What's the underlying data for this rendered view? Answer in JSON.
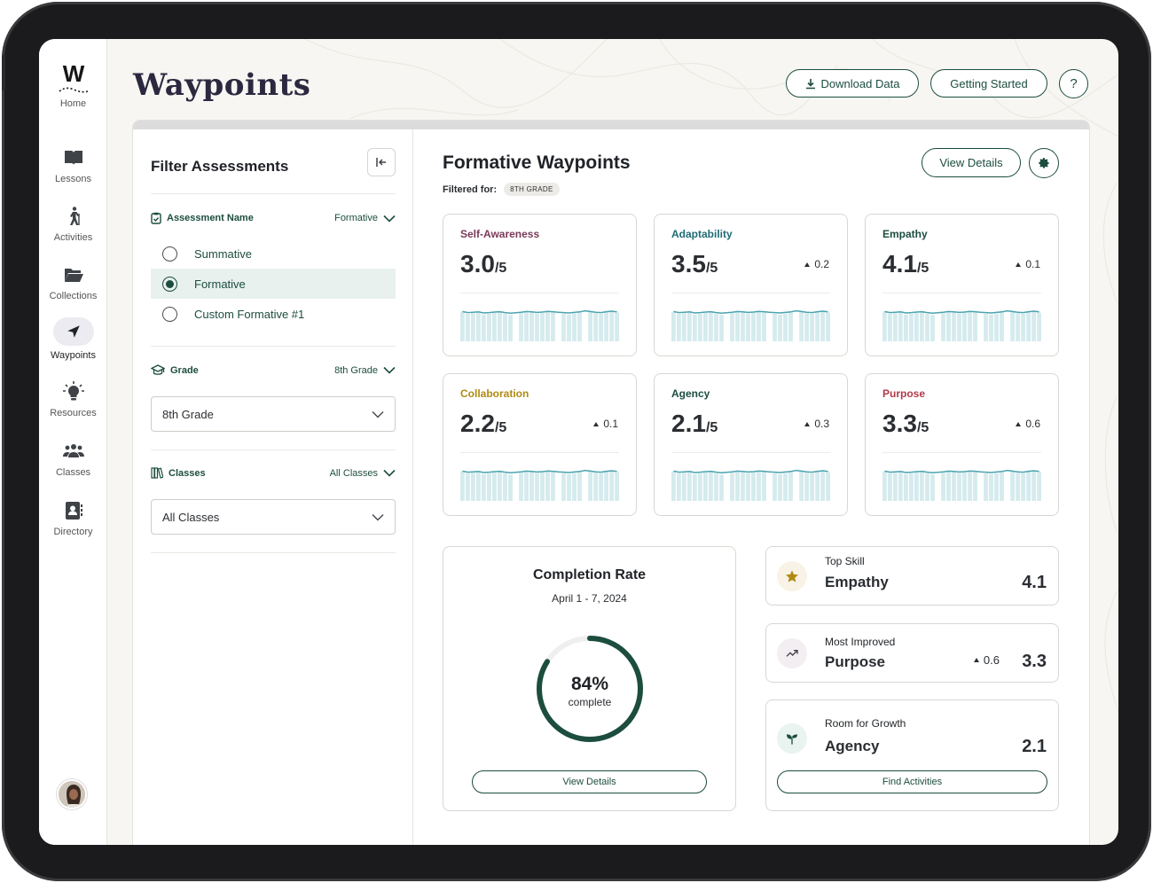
{
  "app": {
    "title": "Waypoints",
    "logo_letter": "W"
  },
  "nav": [
    {
      "label": "Home",
      "icon": "logo-icon"
    },
    {
      "label": "Lessons",
      "icon": "book-icon"
    },
    {
      "label": "Activities",
      "icon": "hiker-icon"
    },
    {
      "label": "Collections",
      "icon": "folder-icon"
    },
    {
      "label": "Waypoints",
      "icon": "navigation-arrow-icon",
      "active": true
    },
    {
      "label": "Resources",
      "icon": "lightbulb-icon"
    },
    {
      "label": "Classes",
      "icon": "people-icon"
    },
    {
      "label": "Directory",
      "icon": "contact-book-icon"
    }
  ],
  "header": {
    "download_label": "Download Data",
    "started_label": "Getting Started",
    "help_label": "?"
  },
  "filters": {
    "title": "Filter Assessments",
    "assessment": {
      "label": "Assessment Name",
      "value": "Formative",
      "options": [
        "Summative",
        "Formative",
        "Custom Formative #1"
      ],
      "selected_index": 1
    },
    "grade": {
      "label": "Grade",
      "value": "8th Grade",
      "select_value": "8th Grade"
    },
    "classes": {
      "label": "Classes",
      "value": "All Classes",
      "select_value": "All Classes"
    }
  },
  "content": {
    "title": "Formative Waypoints",
    "filtered_label": "Filtered for:",
    "filter_chip": "8TH GRADE",
    "view_details_label": "View Details"
  },
  "skills": [
    {
      "name": "Self-Awareness",
      "score": "3.0",
      "outof": "/5",
      "delta": "",
      "color": "#7a3a5a"
    },
    {
      "name": "Adaptability",
      "score": "3.5",
      "outof": "/5",
      "delta": "0.2",
      "color": "#1e6b73"
    },
    {
      "name": "Empathy",
      "score": "4.1",
      "outof": "/5",
      "delta": "0.1",
      "color": "#1c4d3f"
    },
    {
      "name": "Collaboration",
      "score": "2.2",
      "outof": "/5",
      "delta": "0.1",
      "color": "#b08a12"
    },
    {
      "name": "Agency",
      "score": "2.1",
      "outof": "/5",
      "delta": "0.3",
      "color": "#1c4d3f"
    },
    {
      "name": "Purpose",
      "score": "3.3",
      "outof": "/5",
      "delta": "0.6",
      "color": "#b23a48"
    }
  ],
  "completion": {
    "title": "Completion Rate",
    "date_range": "April 1 - 7, 2024",
    "percent": 84,
    "percent_label": "84%",
    "sub_label": "complete",
    "button_label": "View Details",
    "ring_color": "#1c4d3f"
  },
  "highlights": {
    "top_skill": {
      "label": "Top Skill",
      "name": "Empathy",
      "value": "4.1",
      "icon": "star-icon"
    },
    "most_improved": {
      "label": "Most Improved",
      "name": "Purpose",
      "delta": "0.6",
      "value": "3.3",
      "icon": "trending-up-icon"
    },
    "room_for_growth": {
      "label": "Room for Growth",
      "name": "Agency",
      "value": "2.1",
      "icon": "sprout-icon",
      "button_label": "Find Activities"
    }
  }
}
